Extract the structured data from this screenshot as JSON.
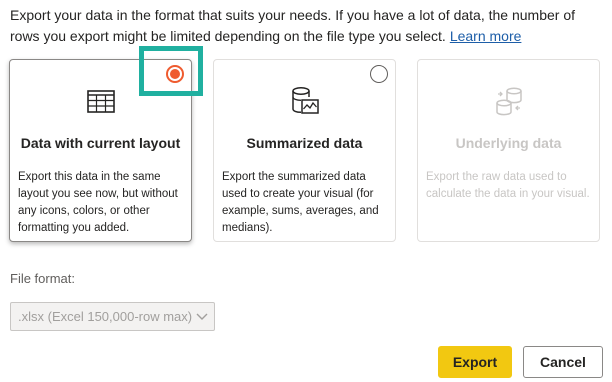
{
  "intro": {
    "text": "Export your data in the format that suits your needs. If you have a lot of data, the number of rows you export might be limited depending on the file type you select.",
    "learn_more": "Learn more"
  },
  "options": [
    {
      "title": "Data with current layout",
      "description": "Export this data in the same layout you see now, but without any icons, colors, or other formatting you added.",
      "selected": true,
      "enabled": true,
      "icon": "table-icon"
    },
    {
      "title": "Summarized data",
      "description": "Export the summarized data used to create your visual (for example, sums, averages, and medians).",
      "selected": false,
      "enabled": true,
      "icon": "database-chart-icon"
    },
    {
      "title": "Underlying data",
      "description": "Export the raw data used to calculate the data in your visual.",
      "selected": false,
      "enabled": false,
      "icon": "database-sync-icon"
    }
  ],
  "file_format": {
    "label": "File format:",
    "value": ".xlsx (Excel 150,000-row max)"
  },
  "buttons": {
    "export": "Export",
    "cancel": "Cancel"
  },
  "colors": {
    "accent": "#f2c811",
    "radio_selected": "#ef5b2f",
    "highlight": "#20b0a0",
    "link": "#1d5ea8"
  }
}
